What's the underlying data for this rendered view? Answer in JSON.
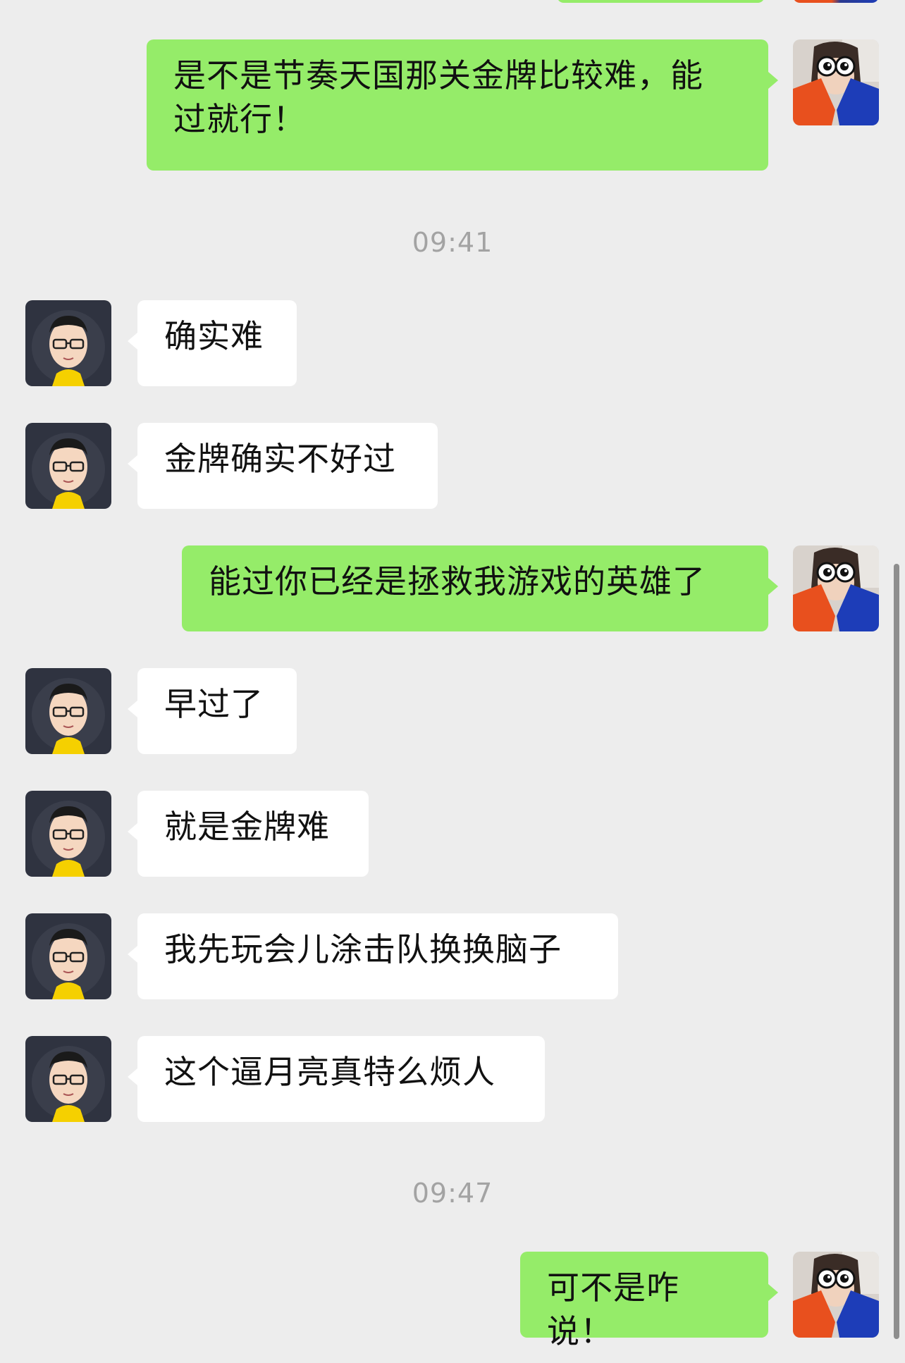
{
  "timestamps": [
    "09:41",
    "09:47"
  ],
  "messages": [
    {
      "side": "right",
      "text": "是不是节奏天国那关金牌比较难，能\n过就行！"
    },
    {
      "side": "left",
      "text": "确实难"
    },
    {
      "side": "left",
      "text": "金牌确实不好过"
    },
    {
      "side": "right",
      "text": "能过你已经是拯救我游戏的英雄了"
    },
    {
      "side": "left",
      "text": "早过了"
    },
    {
      "side": "left",
      "text": "就是金牌难"
    },
    {
      "side": "left",
      "text": "我先玩会儿涂击队换换脑子"
    },
    {
      "side": "left",
      "text": "这个逼月亮真特么烦人"
    },
    {
      "side": "right",
      "text": "可不是咋说！"
    }
  ],
  "colors": {
    "background": "#ededed",
    "bubble_self": "#95ec69",
    "bubble_other": "#ffffff",
    "timestamp_text": "#a3a3a3"
  },
  "avatars": {
    "self": "cartoon-eyes-girl-avatar",
    "other": "glasses-man-avatar"
  }
}
